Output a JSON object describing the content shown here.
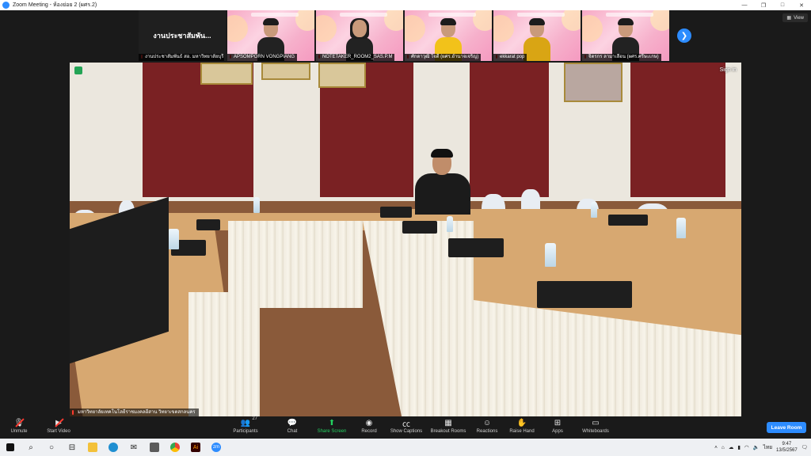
{
  "window": {
    "title": "Zoom Meeting - ห้องย่อย 2 (ผศร.2)",
    "controls": [
      "—",
      "❐",
      "□",
      "✕"
    ]
  },
  "view_button": {
    "label": "View"
  },
  "thumbnails": [
    {
      "big_label": "งานประชาสัมพัน...",
      "name": "งานประชาสัมพันธ์ สอ. มหาวิทยาลัยบุรี",
      "type": "text"
    },
    {
      "name": "APSOMPORN VONGPIANG",
      "type": "person",
      "variant": ""
    },
    {
      "name": "NOTETAKER_ROOM2_SAS.P.M",
      "type": "person",
      "variant": "long"
    },
    {
      "name": "ศักดาวุฒิ ใจดี (ผศร.อำนาจเจริญ)",
      "type": "person",
      "variant": "yellow"
    },
    {
      "name": "ekkarat pop",
      "type": "person",
      "variant": "darkyellow"
    },
    {
      "name": "จิตรกร ลามาเลือน (ผศร.ศรีษะเกษ)",
      "type": "person",
      "variant": ""
    }
  ],
  "main_video": {
    "sign_in": "Sign in",
    "name": "มหาวิทยาลัยเทคโนโลยีราชมงคลอีสาน วิทยาเขตสกลนคร"
  },
  "toolbar": {
    "unmute": "Unmute",
    "start_video": "Start Video",
    "participants": "Participants",
    "participants_count": "27",
    "chat": "Chat",
    "share_screen": "Share Screen",
    "record": "Record",
    "show_captions": "Show Captions",
    "breakout_rooms": "Breakout Rooms",
    "reactions": "Reactions",
    "raise_hand": "Raise Hand",
    "apps": "Apps",
    "whiteboards": "Whiteboards",
    "leave_room": "Leave Room"
  },
  "taskbar": {
    "lang": "ไทย",
    "time": "9:47",
    "date": "13/5/2567"
  }
}
